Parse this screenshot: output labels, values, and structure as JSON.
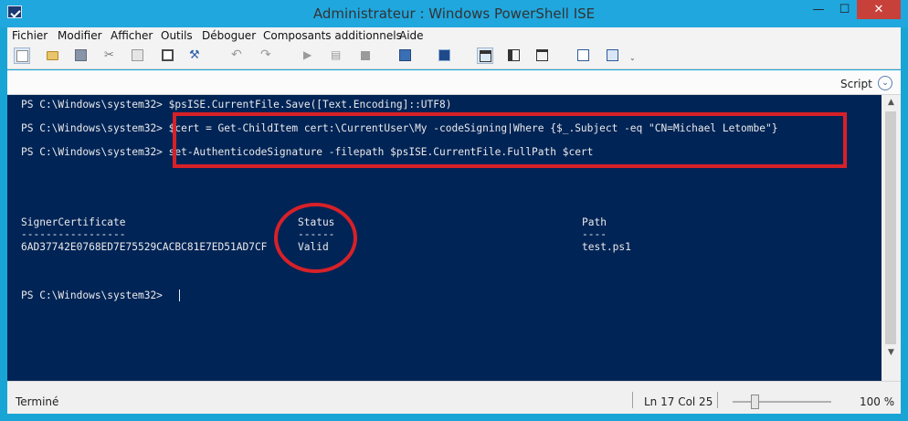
{
  "window": {
    "title": "Administrateur : Windows PowerShell ISE",
    "controls": {
      "minimize": "—",
      "maximize": "☐",
      "close": "✕"
    }
  },
  "menu": [
    "Fichier",
    "Modifier",
    "Afficher",
    "Outils",
    "Déboguer",
    "Composants additionnels",
    "Aide"
  ],
  "toolbar_icons": [
    "new-script-icon",
    "open-icon",
    "save-icon",
    "cut-icon",
    "copy-icon",
    "paste-icon",
    "clear-console-icon",
    "undo-icon",
    "redo-icon",
    "run-icon",
    "run-selection-icon",
    "stop-icon",
    "remote-powershell-icon",
    "powershell-console-icon",
    "layout-script-top-icon",
    "layout-script-right-icon",
    "layout-script-maximized-icon",
    "command-addon-icon",
    "toolbar-overflow-icon"
  ],
  "script_pane": {
    "label": "Script",
    "collapse_icon": "⌄"
  },
  "console": {
    "lines": [
      "PS C:\\Windows\\system32> $psISE.CurrentFile.Save([Text.Encoding]::UTF8)",
      "PS C:\\Windows\\system32> $cert = Get-ChildItem cert:\\CurrentUser\\My -codeSigning|Where {$_.Subject -eq \"CN=Michael Letombe\"}",
      "PS C:\\Windows\\system32> set-AuthenticodeSignature -filepath $psISE.CurrentFile.FullPath $cert"
    ],
    "table": {
      "headers": [
        "SignerCertificate",
        "Status",
        "Path"
      ],
      "dividers": [
        "-----------------",
        "------",
        "----"
      ],
      "row": [
        "6AD37742E0768ED7E75529CACBC81E7ED51AD7CF",
        "Valid",
        "test.ps1"
      ]
    },
    "prompt": "PS C:\\Windows\\system32> "
  },
  "statusbar": {
    "status": "Terminé",
    "position": "Ln 17  Col 25",
    "zoom_percent": 100,
    "zoom_label": "100 %"
  },
  "colors": {
    "console_bg": "#012456",
    "console_fg": "#eaeaea",
    "highlight": "#d72128",
    "title_bg": "#20a7de",
    "close_button": "#c7413a"
  }
}
